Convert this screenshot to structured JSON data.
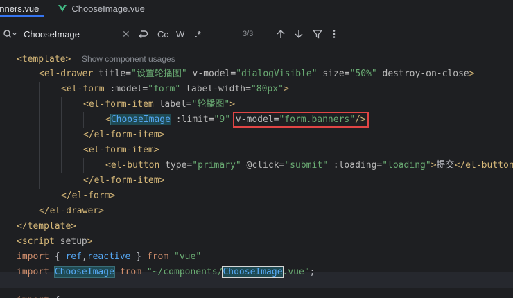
{
  "tabs": [
    {
      "label": "anners.vue",
      "active": true
    },
    {
      "label": "ChooseImage.vue",
      "active": false,
      "icon": "vue-icon"
    }
  ],
  "search": {
    "query": "ChooseImage",
    "case_label": "Cc",
    "word_label": "W",
    "regex_label": ".*",
    "match_count": "3/3"
  },
  "code": {
    "l1": {
      "tag": "<template>",
      "hint": "Show component usages"
    },
    "l2": {
      "open": "<el-drawer",
      "a1": " title=",
      "v1": "\"设置轮播图\"",
      "a2": " v-model=",
      "v2": "\"dialogVisible\"",
      "a3": " size=",
      "v3": "\"50%\"",
      "a4": " destroy-on-close",
      "close": ">"
    },
    "l3": {
      "open": "<el-form",
      "a1": " :model=",
      "v1": "\"form\"",
      "a2": " label-width=",
      "v2": "\"80px\"",
      "close": ">"
    },
    "l4": {
      "open": "<el-form-item",
      "a1": " label=",
      "v1": "\"轮播图\"",
      "close": ">"
    },
    "l5": {
      "lt": "<",
      "comp": "ChooseImage",
      "a1": " :limit=",
      "v1": "\"9\"",
      "a2": "v-model=",
      "v2": "\"form.banners\"",
      "close": "/>"
    },
    "l6": {
      "tag": "</el-form-item>"
    },
    "l7": {
      "tag": "<el-form-item>"
    },
    "l8": {
      "open": "<el-button",
      "a1": " type=",
      "v1": "\"primary\"",
      "a2": " @click=",
      "v2": "\"submit\"",
      "a3": " :loading=",
      "v3": "\"loading\"",
      "gt": ">",
      "text": "提交",
      "close": "</el-button>"
    },
    "l9": {
      "tag": "</el-form-item>"
    },
    "l10": {
      "tag": "</el-form>"
    },
    "l11": {
      "tag": "</el-drawer>"
    },
    "l12": {
      "tag": "</template>"
    },
    "l13": {
      "open": "<script",
      "a1": " setup",
      "close": ">"
    },
    "l14": {
      "kw1": "import",
      "p1": " { ",
      "id1": "ref",
      "p2": ",",
      "id2": "reactive",
      "p3": " } ",
      "kw2": "from",
      "sp": " ",
      "str": "\"vue\""
    },
    "l15": {
      "kw1": "import",
      "sp1": " ",
      "comp": "ChooseImage",
      "sp2": " ",
      "kw2": "from",
      "sp3": " ",
      "s1": "\"~/components/",
      "comp2": "ChooseImage",
      "s2": ".vue\"",
      "semi": ";"
    },
    "l16": {
      "kw": "import",
      "rest": " {"
    }
  }
}
